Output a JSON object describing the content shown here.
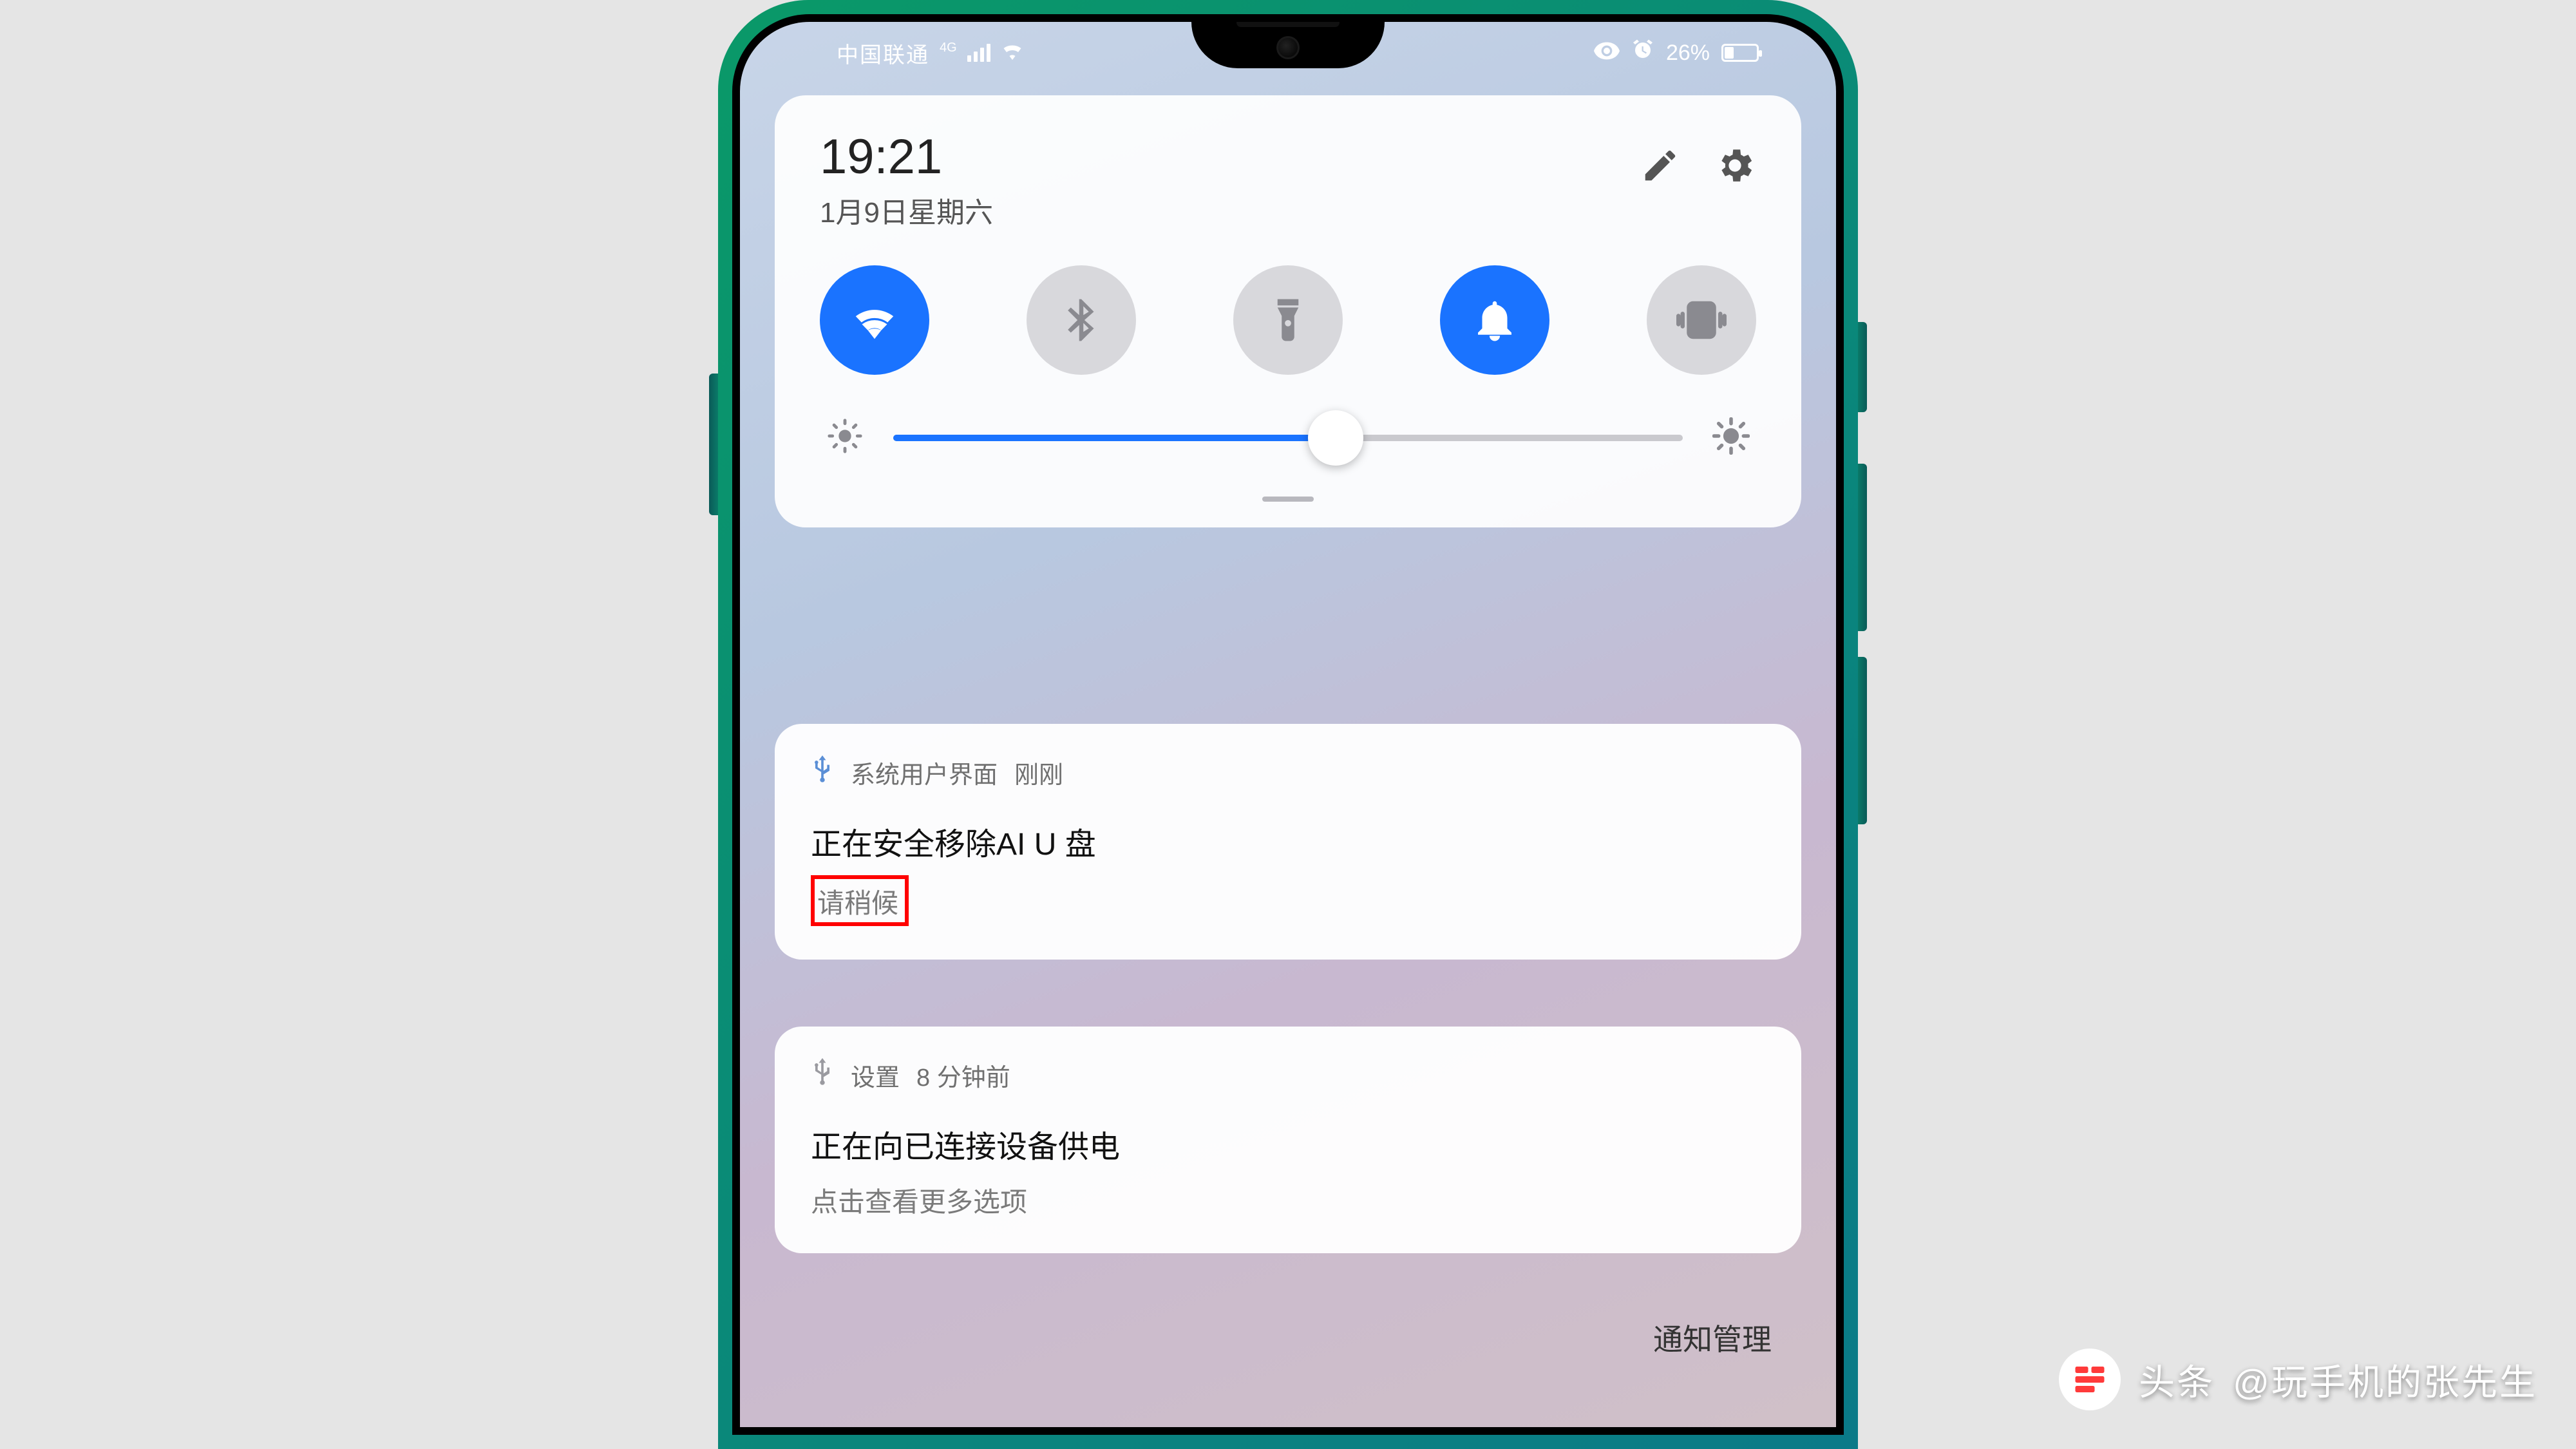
{
  "status": {
    "carrier": "中国联通",
    "network": "4G",
    "battery_text": "26%",
    "battery_level": 26,
    "eye_protect": true,
    "alarm": true
  },
  "panel": {
    "time": "19:21",
    "date": "1月9日星期六",
    "tiles": {
      "wifi": {
        "active": true
      },
      "bluetooth": {
        "active": false
      },
      "flashlight": {
        "active": false
      },
      "bell": {
        "active": true
      },
      "vibrate": {
        "active": false
      }
    },
    "brightness": 56
  },
  "notifications": [
    {
      "app": "系统用户界面",
      "time": "刚刚",
      "title": "正在安全移除AI U 盘",
      "subtitle": "请稍候",
      "highlight_subtitle": true
    },
    {
      "app": "设置",
      "time": "8 分钟前",
      "title": "正在向已连接设备供电",
      "subtitle": "点击查看更多选项",
      "highlight_subtitle": false
    }
  ],
  "footer": {
    "manage": "通知管理"
  },
  "watermark": {
    "label": "头条",
    "author": "@玩手机的张先生"
  }
}
